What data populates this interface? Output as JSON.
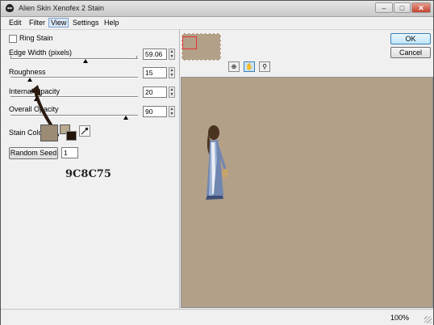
{
  "window": {
    "title": "Alien Skin Xenofex 2 Stain"
  },
  "menu": [
    "Edit",
    "Filter",
    "View",
    "Settings",
    "Help"
  ],
  "controls": {
    "ring_stain_label": "Ring Stain",
    "ring_stain_checked": false,
    "sliders": [
      {
        "label": "Edge Width (pixels)",
        "value": "59.06"
      },
      {
        "label": "Roughness",
        "value": "15"
      },
      {
        "label": "Internal Opacity",
        "value": "20"
      },
      {
        "label": "Overall Opacity",
        "value": "90"
      }
    ],
    "stain_color_label": "Stain Color",
    "stain_color": "#9C8C75",
    "random_seed_label": "Random Seed",
    "random_seed_value": "1"
  },
  "annotation": "9C8C75",
  "buttons": {
    "ok": "OK",
    "cancel": "Cancel"
  },
  "status": {
    "zoom": "100%"
  },
  "colors": {
    "preview_bg": "#b2a088",
    "nav_rect": "#e53333"
  },
  "icons": [
    "app-icon",
    "minimize-icon",
    "maximize-icon",
    "close-icon",
    "eyedropper-icon",
    "zoom-tool-icon",
    "hand-tool-icon",
    "magnifier-icon"
  ]
}
